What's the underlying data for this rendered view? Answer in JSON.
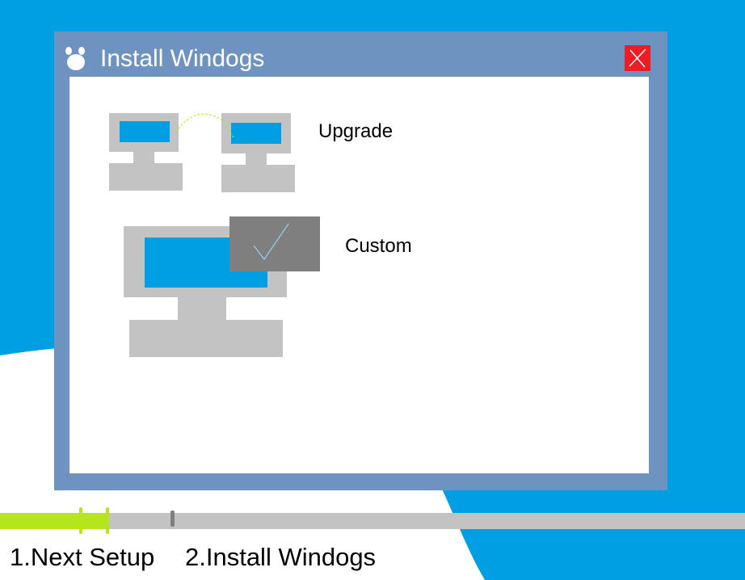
{
  "window": {
    "title": "Install Windogs",
    "logo_icon": "paw-logo-icon",
    "close_icon": "close-x-icon"
  },
  "options": [
    {
      "label": "Upgrade",
      "icon": "two-computers-upgrade-icon",
      "selected": false
    },
    {
      "label": "Custom",
      "icon": "computer-custom-icon",
      "selected": true
    }
  ],
  "progress": {
    "fraction": 0.145,
    "steps": [
      {
        "label": "1.Next Setup"
      },
      {
        "label": "2.Install Windogs"
      }
    ]
  },
  "colors": {
    "desktop_blue": "#009fe3",
    "window_frame": "#6f93c1",
    "close_red": "#ee1c24",
    "monitor_gray": "#c3c3c3",
    "screen_blue": "#009fe3",
    "check_gray": "#7f7f7f",
    "progress_green": "#b5e61d"
  }
}
